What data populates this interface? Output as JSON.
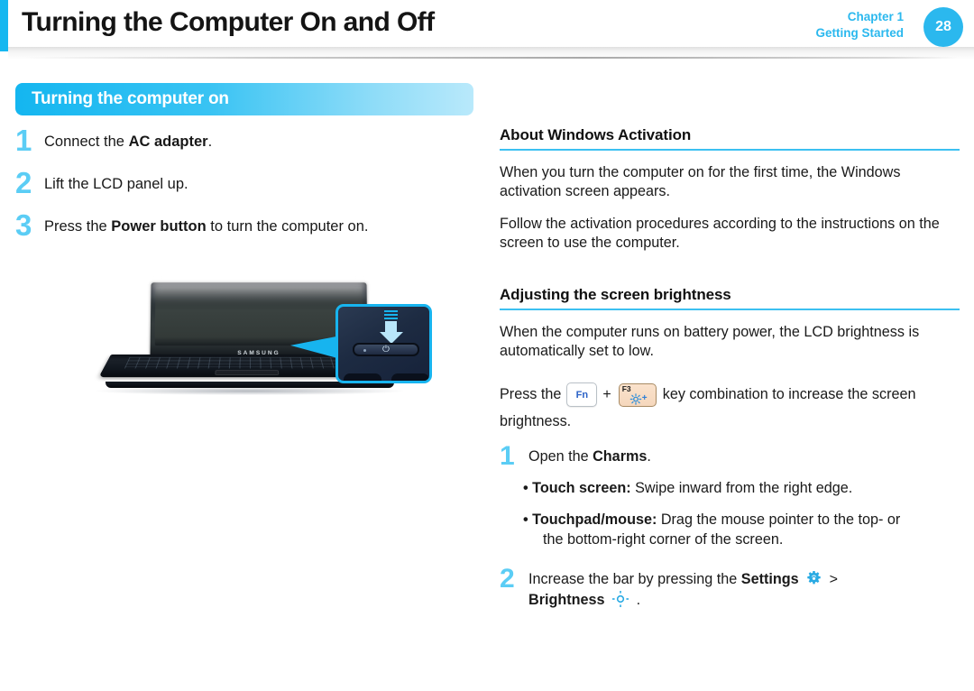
{
  "header": {
    "title": "Turning the Computer On and Off",
    "chapter": "Chapter 1",
    "chapter_sub": "Getting Started",
    "page_number": "28",
    "accent_color": "#16b7f0",
    "badge_color": "#2bb8ee"
  },
  "section": {
    "banner_title": "Turning the computer on",
    "banner_gradient_from": "#14b6f0",
    "banner_gradient_to": "#b9e9fb"
  },
  "left_column": {
    "steps": [
      {
        "num": "1",
        "pre": "Connect the ",
        "bold": "AC adapter",
        "post": "."
      },
      {
        "num": "2",
        "pre": "Lift the LCD panel up.",
        "bold": "",
        "post": ""
      },
      {
        "num": "3",
        "pre": "Press the ",
        "bold": "Power button",
        "post": " to turn the computer on."
      }
    ],
    "figure": {
      "laptop_brand": "SAMSUNG",
      "callout_label": "power-button-closeup",
      "power_glyph": "⏻"
    }
  },
  "right_column": {
    "section_activation": {
      "heading": "About Windows Activation",
      "paragraphs": [
        "When you turn the computer on for the first time, the Windows activation screen appears.",
        "Follow the activation procedures according to the instructions on the screen to use the computer."
      ]
    },
    "section_brightness": {
      "heading": "Adjusting the screen brightness",
      "paragraph": "When the computer runs on battery power, the LCD brightness is automatically set to low.",
      "key_sentence_pre": "Press the ",
      "key_fn_label": "Fn",
      "key_plus": "+",
      "key_f3_label": "F3",
      "key_f3_plus": "+",
      "key_sentence_post": " key combination to increase the screen",
      "key_sentence_wrap": "brightness.",
      "steps": [
        {
          "num": "1",
          "pre": "Open the ",
          "bold": "Charms",
          "post": ".",
          "bullets": [
            {
              "bold": "• Touch screen:",
              "text": " Swipe inward from the right edge.",
              "cont": ""
            },
            {
              "bold": "• Touchpad/mouse:",
              "text": " Drag the mouse pointer to the top- or",
              "cont": "the bottom-right corner of the screen."
            }
          ]
        },
        {
          "num": "2",
          "pre": "Increase the bar by pressing the ",
          "bold": "Settings",
          "gear_icon": "gear-icon",
          "separator": ">",
          "bold2": "Brightness",
          "sun_icon": "brightness-icon",
          "post": "."
        }
      ]
    }
  },
  "colors": {
    "accent_blue": "#2bb8ee",
    "number_blue": "#5bcdf5",
    "rule_blue": "#3cc0f1",
    "text_black": "#1a1a1a",
    "key_fn_text": "#2b62c7",
    "key_f3_bg": "#f7dfc8"
  }
}
